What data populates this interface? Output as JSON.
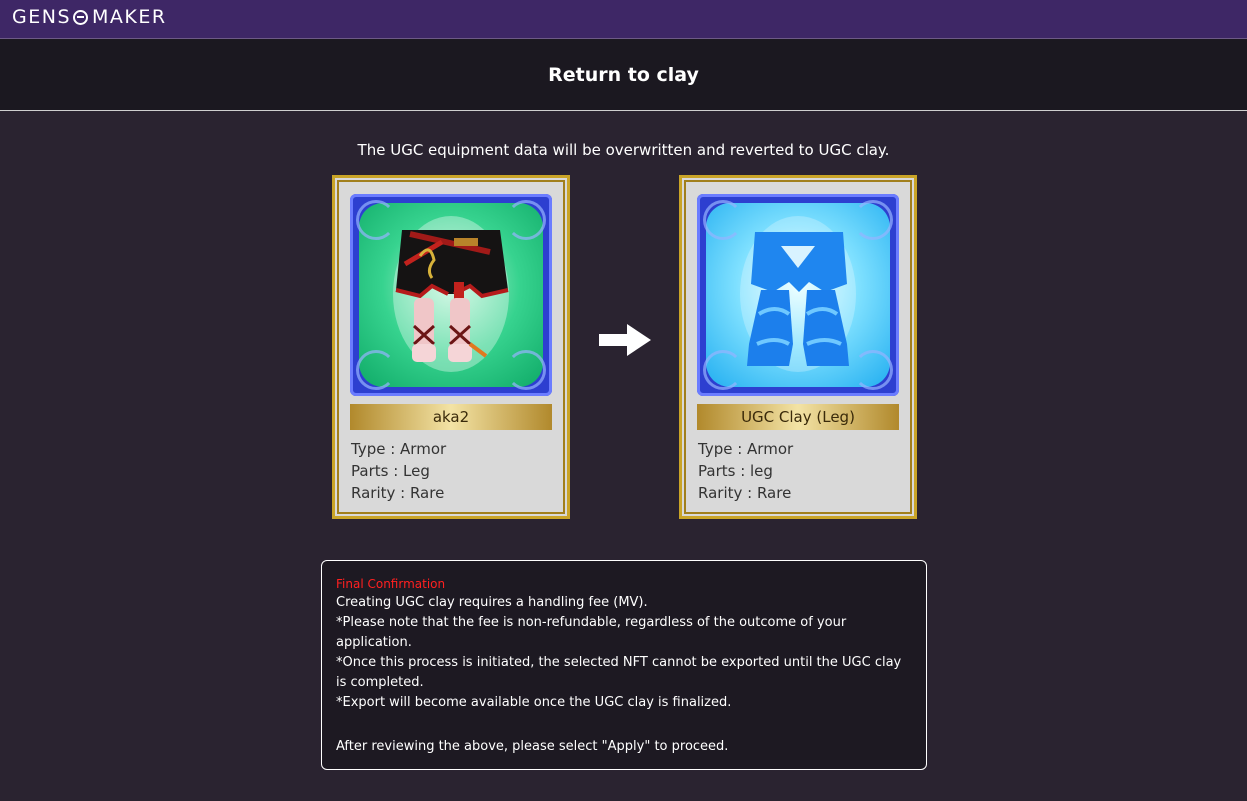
{
  "app": {
    "logo_text_1": "GENS",
    "logo_text_2": "MAKER"
  },
  "header": {
    "title": "Return to clay"
  },
  "intro": "The UGC equipment data will be overwritten and reverted to UGC clay.",
  "cards": [
    {
      "name": "aka2",
      "type": "Type : Armor",
      "parts": "Parts : Leg",
      "rarity": "Rarity : Rare",
      "icon": "leg-armor-icon",
      "bg_color": "#1fc07a"
    },
    {
      "name": "UGC Clay (Leg)",
      "type": "Type : Armor",
      "parts": "Parts : leg",
      "rarity": "Rarity : Rare",
      "icon": "clay-leg-armor-icon",
      "bg_color": "#45c3f5"
    }
  ],
  "arrow_icon": "arrow-right-icon",
  "notice": {
    "title": "Final Confirmation",
    "lines": [
      "Creating UGC clay requires a handling fee (MV).",
      "*Please note that the fee is non-refundable, regardless of the outcome of your application.",
      "*Once this process is initiated, the selected NFT cannot be exported until the UGC clay is completed.",
      "*Export will become available once the UGC clay is finalized."
    ],
    "footer": "After reviewing the above, please select \"Apply\" to proceed."
  },
  "colors": {
    "topbar": "#3e2766",
    "background": "#2a2330",
    "gold": "#c9a427",
    "warning": "#ff2020"
  }
}
